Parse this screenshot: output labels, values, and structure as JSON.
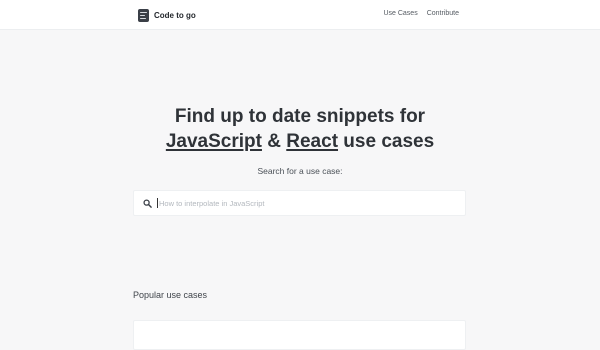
{
  "navbar": {
    "brand": "Code to go",
    "links": [
      "Use Cases",
      "Contribute"
    ]
  },
  "hero": {
    "line1": "Find up to date snippets for",
    "lang1": "JavaScript",
    "amp": "&",
    "lang2": "React",
    "suffix": "use cases"
  },
  "search": {
    "label": "Search for a use case:",
    "placeholder": "How to interpolate in JavaScript",
    "value": ""
  },
  "popular": {
    "title": "Popular use cases"
  },
  "colors": {
    "background": "#f7f7f8",
    "surface": "#ffffff",
    "text": "#2f3338"
  }
}
